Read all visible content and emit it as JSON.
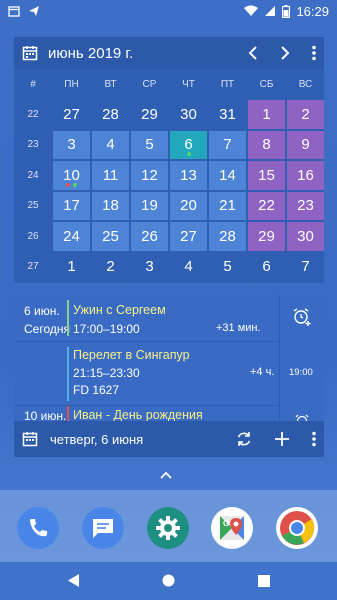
{
  "status": {
    "time": "16:29"
  },
  "calendar": {
    "title": "июнь 2019 г.",
    "week_header": "#",
    "dows": [
      "ПН",
      "ВТ",
      "СР",
      "ЧТ",
      "ПТ",
      "СБ",
      "ВС"
    ],
    "weeks": [
      {
        "num": "22",
        "days": [
          "27",
          "28",
          "29",
          "30",
          "31",
          "1",
          "2"
        ],
        "types": [
          "",
          "",
          "",
          "",
          "",
          "we",
          "we"
        ]
      },
      {
        "num": "23",
        "days": [
          "3",
          "4",
          "5",
          "6",
          "7",
          "8",
          "9"
        ],
        "types": [
          "cur",
          "cur",
          "cur",
          "today",
          "cur",
          "we",
          "we"
        ]
      },
      {
        "num": "24",
        "days": [
          "10",
          "11",
          "12",
          "13",
          "14",
          "15",
          "16"
        ],
        "types": [
          "cur",
          "cur",
          "cur",
          "cur",
          "cur",
          "we",
          "we"
        ]
      },
      {
        "num": "25",
        "days": [
          "17",
          "18",
          "19",
          "20",
          "21",
          "22",
          "23"
        ],
        "types": [
          "cur",
          "cur",
          "cur",
          "cur",
          "cur",
          "we",
          "we"
        ]
      },
      {
        "num": "26",
        "days": [
          "24",
          "25",
          "26",
          "27",
          "28",
          "29",
          "30"
        ],
        "types": [
          "cur",
          "cur",
          "cur",
          "cur",
          "cur",
          "we",
          "we"
        ]
      },
      {
        "num": "27",
        "days": [
          "1",
          "2",
          "3",
          "4",
          "5",
          "6",
          "7"
        ],
        "types": [
          "",
          "",
          "",
          "",
          "",
          "",
          ""
        ]
      }
    ],
    "colors": {
      "current": "#4d84d6",
      "weekend": "#8f63c4",
      "today": "#22a7bd",
      "dot_green": "#56d16a",
      "dot_red": "#e0504b"
    }
  },
  "agenda": {
    "events": [
      {
        "date": "6 июн.",
        "day_label": "Сегодня",
        "title": "Ужин с Сергеем",
        "time": "17:00–19:00",
        "duration": "+31 мин.",
        "title_color": "#f6f08a",
        "bar_color": "#8ccf8c"
      },
      {
        "title": "Перелет в Сингапур",
        "time": "21:15–23:30",
        "extra": "FD 1627",
        "duration": "+4 ч.",
        "side_time": "19:00",
        "title_color": "#f6f08a",
        "bar_color": "#4fb3e8"
      },
      {
        "date": "10 июн.",
        "title": "Иван - День рождения",
        "title_color": "#f6f08a",
        "bar_color": "#e0504b"
      }
    ],
    "footer_title": "четверг, 6 июня"
  },
  "dock": {
    "apps": [
      {
        "icon": "phone-icon",
        "color": "#4a86e8"
      },
      {
        "icon": "messages-icon",
        "color": "#4a86e8"
      },
      {
        "icon": "settings-icon",
        "color": "#1f8f84"
      },
      {
        "icon": "maps-icon",
        "color": "#ffffff"
      },
      {
        "icon": "chrome-icon",
        "color": "#ffffff"
      }
    ]
  }
}
